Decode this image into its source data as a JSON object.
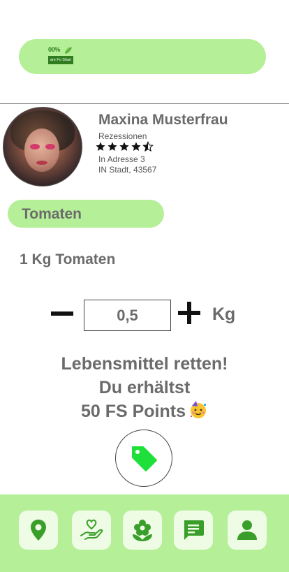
{
  "header": {
    "logo_percent": "00%",
    "logo_banner": "are Fo Shari"
  },
  "profile": {
    "name": "Maxina Musterfrau",
    "reviews_label": "Rezessionen",
    "rating": 4.5,
    "rating_max": 5,
    "address_line1": "In Adresse 3",
    "address_line2": "IN Stadt, 43567"
  },
  "product": {
    "title": "Tomaten",
    "description": "1 Kg Tomaten"
  },
  "quantity": {
    "value": "0,5",
    "unit": "Kg"
  },
  "promo": {
    "line1": "Lebensmittel retten!",
    "line2": "Du erhältst",
    "line3": "50 FS Points",
    "emoji": "🥳"
  },
  "colors": {
    "accent": "#b5ef98",
    "nav_button_bg": "#eefce5",
    "tag_icon": "#1fe03a",
    "icon_green": "#3a9e2a"
  },
  "nav": {
    "items": [
      {
        "icon": "map-pin-icon"
      },
      {
        "icon": "hand-heart-icon"
      },
      {
        "icon": "flower-icon"
      },
      {
        "icon": "chat-icon"
      },
      {
        "icon": "user-icon"
      }
    ]
  }
}
